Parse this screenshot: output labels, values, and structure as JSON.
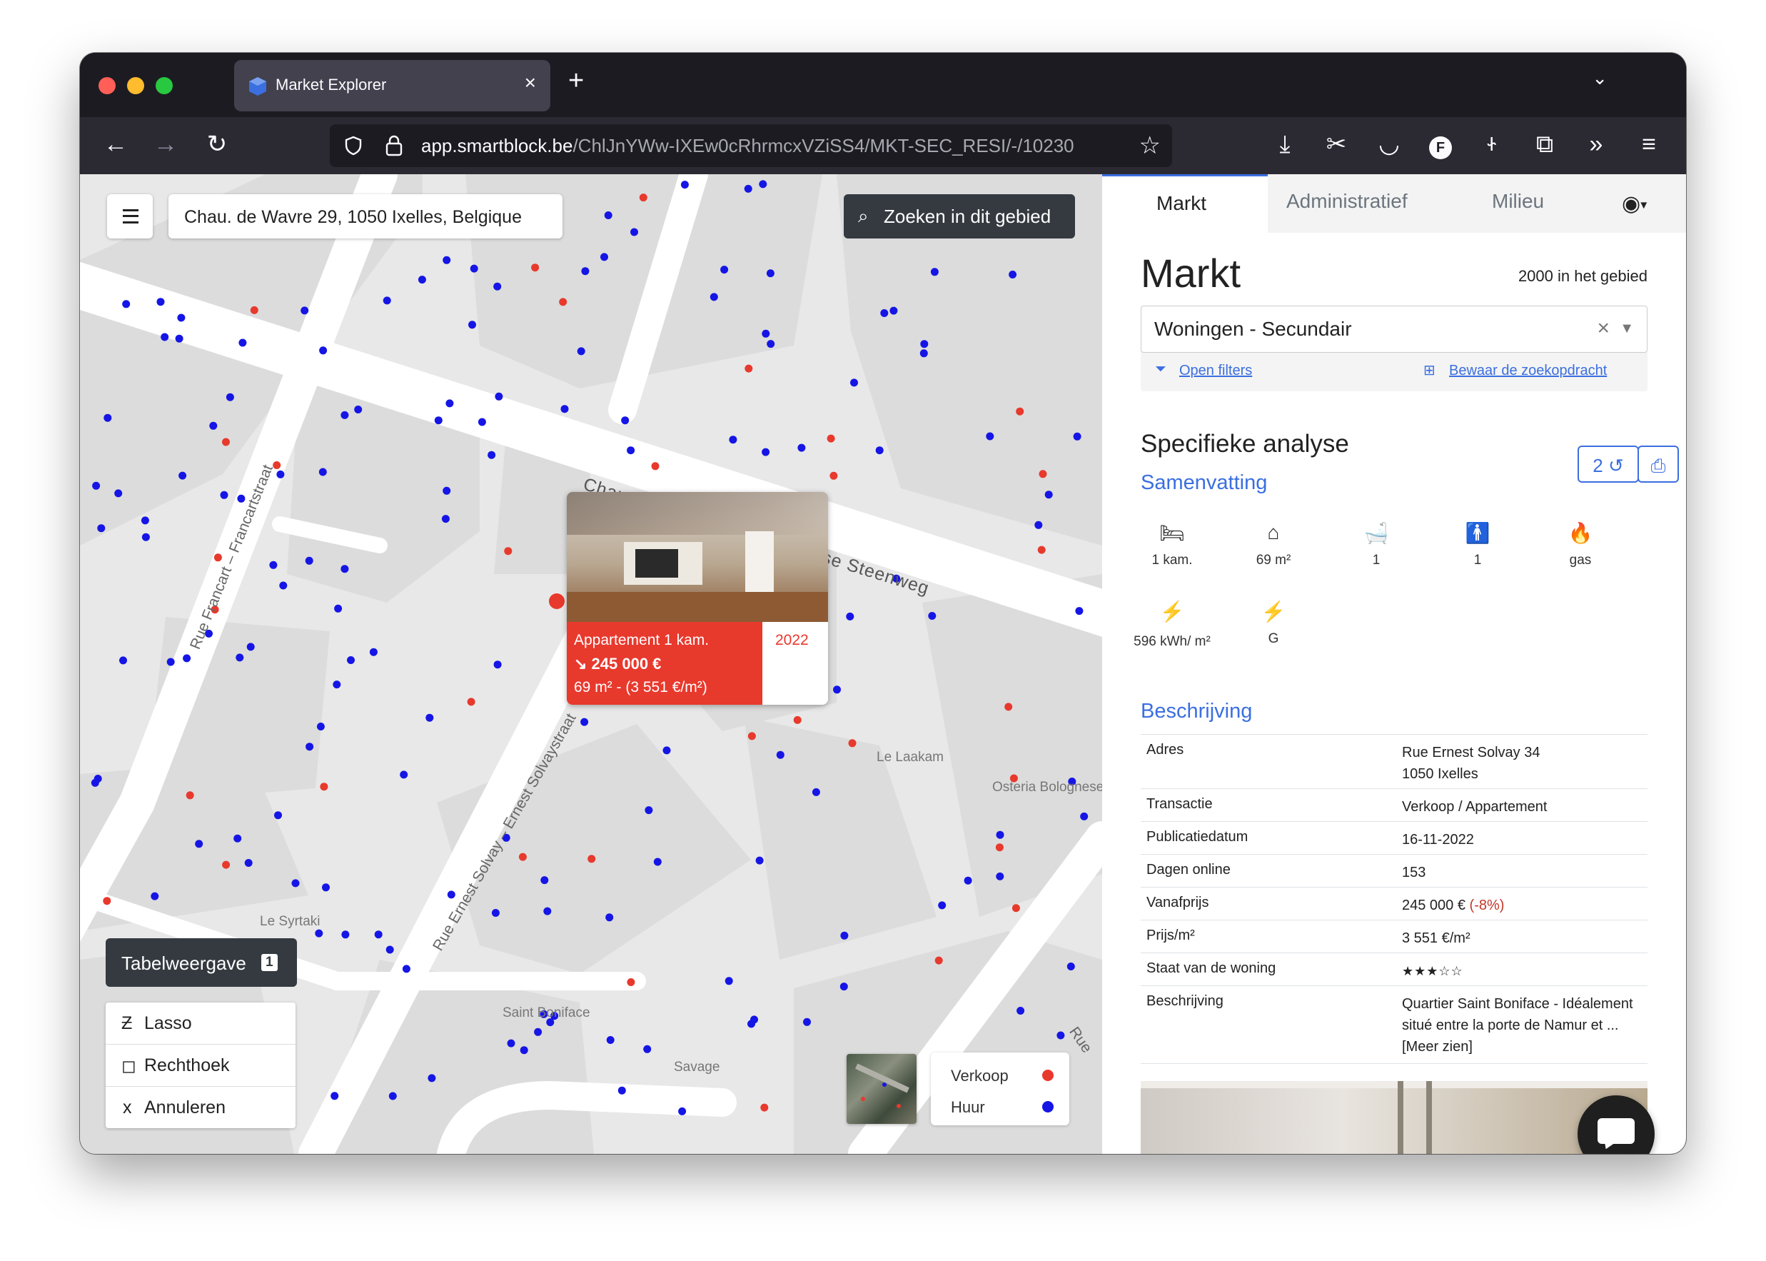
{
  "browser": {
    "tab_title": "Market Explorer",
    "url_domain": "app.smartblock.be",
    "url_path": "/ChlJnYWw-IXEw0cRhrmcxVZiSS4/MKT-SEC_RESI/-/10230"
  },
  "map": {
    "address": "Chau. de Wavre 29, 1050 Ixelles, Belgique",
    "search_area_label": "Zoeken in dit gebied",
    "table_view_label": "Tabelweergave",
    "table_view_count": "1",
    "tools": [
      {
        "icon": "Ƶ",
        "label": "Lasso"
      },
      {
        "icon": "◻",
        "label": "Rechthoek"
      },
      {
        "icon": "x",
        "label": "Annuleren"
      }
    ],
    "street_labels": {
      "chaussee": "Chaussée de Wavre – Waversе Steenweg",
      "francart": "Rue Francart – Francartstraat",
      "solvay": "Rue Ernest Solvay – Ernest Solvaystraat",
      "laakam": "Le Laakam",
      "osteria": "Osteria Bolognese",
      "syrtaki": "Le Syrtaki",
      "boniface": "Saint Boniface",
      "savage": "Savage",
      "rue": "Rue"
    },
    "legend": [
      {
        "label": "Verkoop",
        "color": "#e8392d"
      },
      {
        "label": "Huur",
        "color": "#1515e6"
      }
    ],
    "popup": {
      "title": "Appartement 1 kam.",
      "price": "↘ 245 000 €",
      "size": "69 m² - (3 551 €/m²)",
      "year": "2022"
    }
  },
  "panel": {
    "tabs": [
      "Markt",
      "Administratief",
      "Milieu"
    ],
    "heading": "Markt",
    "count_label": "2000 in het gebied",
    "select_value": "Woningen - Secundair",
    "open_filters": "Open filters",
    "save_search": "Bewaar de zoekopdracht",
    "analysis_title": "Specifieke analyse",
    "analysis_badge": "2",
    "summary_title": "Samenvatting",
    "features": [
      {
        "icon": "bed-icon",
        "label": "1 kam."
      },
      {
        "icon": "house-icon",
        "label": "69 m²"
      },
      {
        "icon": "bath-icon",
        "label": "1"
      },
      {
        "icon": "toilet-icon",
        "label": "1"
      },
      {
        "icon": "flame-icon",
        "label": "gas"
      },
      {
        "icon": "bolt-icon",
        "label": "596 kWh/ m²"
      },
      {
        "icon": "bolt-icon",
        "label": "G"
      }
    ],
    "description_title": "Beschrijving",
    "rows": [
      {
        "key": "Adres",
        "value": "Rue Ernest Solvay 34",
        "value2": "1050 Ixelles"
      },
      {
        "key": "Transactie",
        "value": "Verkoop / Appartement"
      },
      {
        "key": "Publicatiedatum",
        "value": "16-11-2022"
      },
      {
        "key": "Dagen online",
        "value": "153"
      },
      {
        "key": "Vanafprijs",
        "value": "245 000 €",
        "value_extra": "(-8%)"
      },
      {
        "key": "Prijs/m²",
        "value": "3 551 €/m²"
      },
      {
        "key": "Staat van de woning",
        "rating": 3,
        "rating_max": 5
      },
      {
        "key": "Beschrijving",
        "value": "Quartier Saint Boniface - Idéalement situé entre la porte de Namur et ... [Meer zien]"
      }
    ]
  },
  "colors": {
    "accent": "#3b6fe0",
    "sale": "#e8392d",
    "rent": "#1515e6",
    "negative": "#c0392b"
  }
}
